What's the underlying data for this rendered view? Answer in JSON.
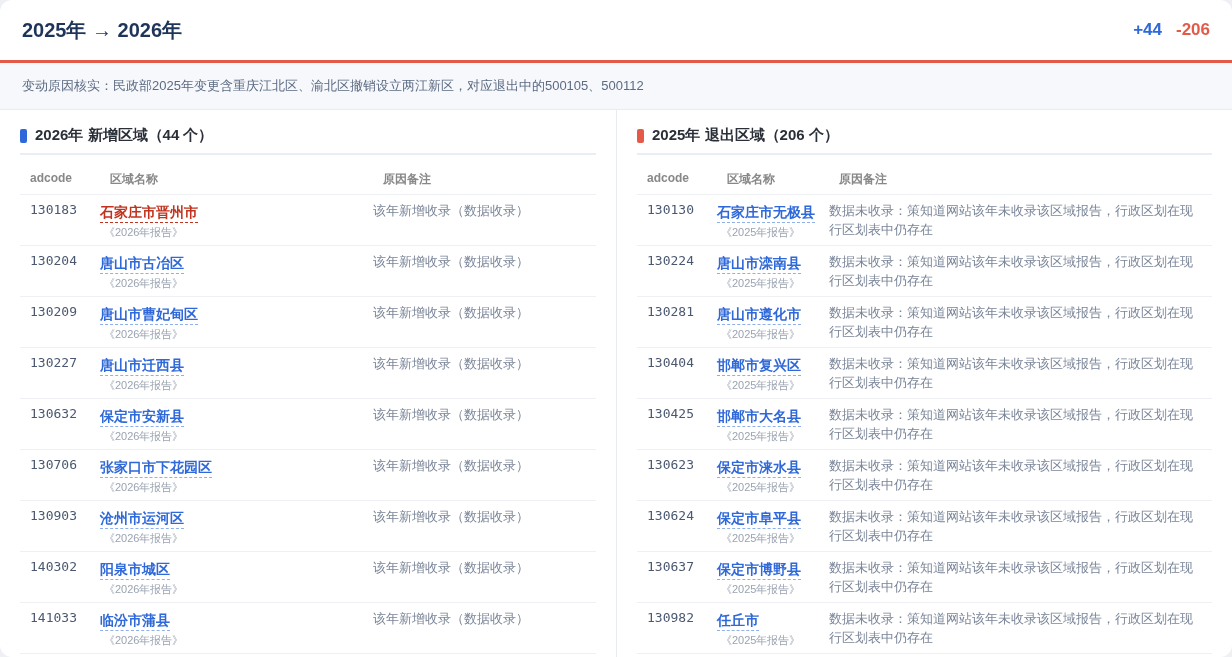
{
  "header": {
    "title": "2025年 → 2026年",
    "added_count": "+44",
    "removed_count": "-206"
  },
  "notice": "变动原因核实：民政部2025年变更含重庆江北区、渝北区撤销设立两江新区，对应退出中的500105、500112",
  "panels": [
    {
      "kind": "added",
      "title": "2026年 新增区域（44 个）",
      "columns": [
        "adcode",
        "区域名称",
        "原因备注"
      ],
      "rows": [
        {
          "adcode": "130183",
          "name": "石家庄市晋州市",
          "source": "《2026年报告》",
          "reason": "该年新增收录（数据收录）",
          "highlighted": true
        },
        {
          "adcode": "130204",
          "name": "唐山市古冶区",
          "source": "《2026年报告》",
          "reason": "该年新增收录（数据收录）",
          "highlighted": false
        },
        {
          "adcode": "130209",
          "name": "唐山市曹妃甸区",
          "source": "《2026年报告》",
          "reason": "该年新增收录（数据收录）",
          "highlighted": false
        },
        {
          "adcode": "130227",
          "name": "唐山市迁西县",
          "source": "《2026年报告》",
          "reason": "该年新增收录（数据收录）",
          "highlighted": false
        },
        {
          "adcode": "130632",
          "name": "保定市安新县",
          "source": "《2026年报告》",
          "reason": "该年新增收录（数据收录）",
          "highlighted": false
        },
        {
          "adcode": "130706",
          "name": "张家口市下花园区",
          "source": "《2026年报告》",
          "reason": "该年新增收录（数据收录）",
          "highlighted": false
        },
        {
          "adcode": "130903",
          "name": "沧州市运河区",
          "source": "《2026年报告》",
          "reason": "该年新增收录（数据收录）",
          "highlighted": false
        },
        {
          "adcode": "140302",
          "name": "阳泉市城区",
          "source": "《2026年报告》",
          "reason": "该年新增收录（数据收录）",
          "highlighted": false
        },
        {
          "adcode": "141033",
          "name": "临汾市蒲县",
          "source": "《2026年报告》",
          "reason": "该年新增收录（数据收录）",
          "highlighted": false
        }
      ]
    },
    {
      "kind": "removed",
      "title": "2025年 退出区域（206 个）",
      "columns": [
        "adcode",
        "区域名称",
        "原因备注"
      ],
      "rows": [
        {
          "adcode": "130130",
          "name": "石家庄市无极县",
          "source": "《2025年报告》",
          "reason": "数据未收录：策知道网站该年未收录该区域报告，行政区划在现行区划表中仍存在",
          "highlighted": false
        },
        {
          "adcode": "130224",
          "name": "唐山市滦南县",
          "source": "《2025年报告》",
          "reason": "数据未收录：策知道网站该年未收录该区域报告，行政区划在现行区划表中仍存在",
          "highlighted": false
        },
        {
          "adcode": "130281",
          "name": "唐山市遵化市",
          "source": "《2025年报告》",
          "reason": "数据未收录：策知道网站该年未收录该区域报告，行政区划在现行区划表中仍存在",
          "highlighted": false
        },
        {
          "adcode": "130404",
          "name": "邯郸市复兴区",
          "source": "《2025年报告》",
          "reason": "数据未收录：策知道网站该年未收录该区域报告，行政区划在现行区划表中仍存在",
          "highlighted": false
        },
        {
          "adcode": "130425",
          "name": "邯郸市大名县",
          "source": "《2025年报告》",
          "reason": "数据未收录：策知道网站该年未收录该区域报告，行政区划在现行区划表中仍存在",
          "highlighted": false
        },
        {
          "adcode": "130623",
          "name": "保定市涞水县",
          "source": "《2025年报告》",
          "reason": "数据未收录：策知道网站该年未收录该区域报告，行政区划在现行区划表中仍存在",
          "highlighted": false
        },
        {
          "adcode": "130624",
          "name": "保定市阜平县",
          "source": "《2025年报告》",
          "reason": "数据未收录：策知道网站该年未收录该区域报告，行政区划在现行区划表中仍存在",
          "highlighted": false
        },
        {
          "adcode": "130637",
          "name": "保定市博野县",
          "source": "《2025年报告》",
          "reason": "数据未收录：策知道网站该年未收录该区域报告，行政区划在现行区划表中仍存在",
          "highlighted": false
        },
        {
          "adcode": "130982",
          "name": "任丘市",
          "source": "《2025年报告》",
          "reason": "数据未收录：策知道网站该年未收录该区域报告，行政区划在现行区划表中仍存在",
          "highlighted": false
        }
      ]
    }
  ]
}
